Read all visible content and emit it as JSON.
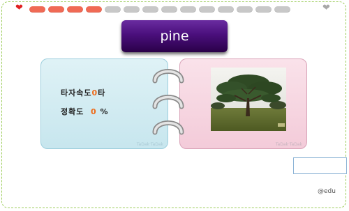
{
  "progress": {
    "total_segments": 14,
    "filled_segments": 4,
    "filled_color": "#f06a55",
    "empty_color": "#c8c8c8",
    "left_icon": "heart-icon",
    "right_icon": "heart-icon"
  },
  "word": {
    "text": "pine"
  },
  "stats": {
    "speed_label": "타자속도",
    "speed_value": "0",
    "speed_unit": "타",
    "accuracy_label": "정확도",
    "accuracy_value": "0",
    "accuracy_unit": "%"
  },
  "cards": {
    "left_watermark": "TaDak·TaDak",
    "right_watermark": "TaDak·TaDak"
  },
  "image": {
    "icon": "pine-tree-photo"
  },
  "footer": {
    "credit": "@edu"
  }
}
